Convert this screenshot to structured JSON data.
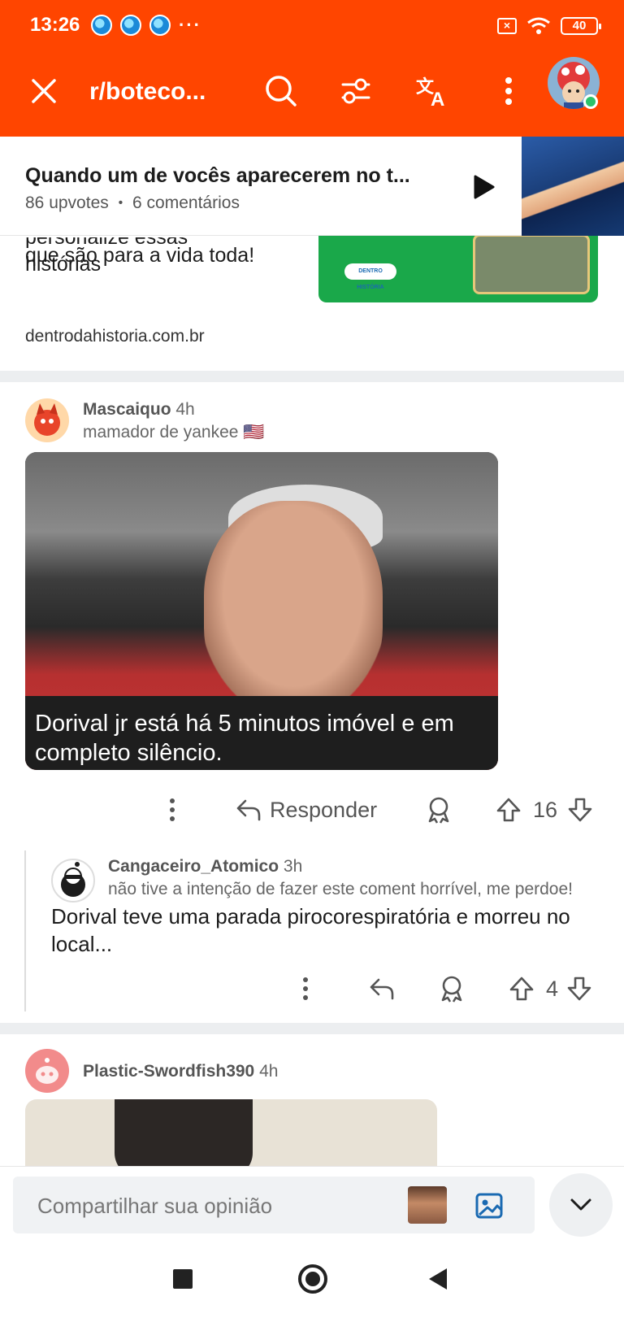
{
  "status_bar": {
    "time": "13:26",
    "more": "···",
    "battery": "40"
  },
  "app_bar": {
    "subreddit_title": "r/boteco..."
  },
  "pinned_post": {
    "title": "Quando um de vocês aparecerem no t...",
    "upvotes": "86 upvotes",
    "dot": "•",
    "comments": "6 comentários"
  },
  "ad": {
    "text_line_cut": "personalize essas histórias",
    "text_line": "que são para a vida toda!",
    "domain": "dentrodahistoria.com.br",
    "logo_text": "DENTRO HISTÓRIA"
  },
  "comments": [
    {
      "username": "Mascaiquo",
      "age": "4h",
      "flair": "mamador de yankee 🇺🇸",
      "image_caption": "Dorival jr está há 5 minutos imóvel e em completo silêncio.",
      "reply_label": "Responder",
      "score": "16"
    },
    {
      "username": "Cangaceiro_Atomico",
      "age": "3h",
      "flair": "não tive a intenção de fazer este coment horrível, me perdoe!",
      "body": "Dorival teve uma parada pirocorespiratória e morreu no local...",
      "score": "4"
    },
    {
      "username": "Plastic-Swordfish390",
      "age": "4h"
    }
  ],
  "composer": {
    "placeholder": "Compartilhar sua opinião"
  },
  "colors": {
    "brand": "#ff4500",
    "online": "#2bc26a"
  },
  "icons": [
    "close-icon",
    "search-icon",
    "filter-icon",
    "translate-icon",
    "more-vertical-icon",
    "play-icon",
    "reply-icon",
    "award-icon",
    "upvote-icon",
    "downvote-icon",
    "image-upload-icon",
    "chevron-down-icon"
  ]
}
